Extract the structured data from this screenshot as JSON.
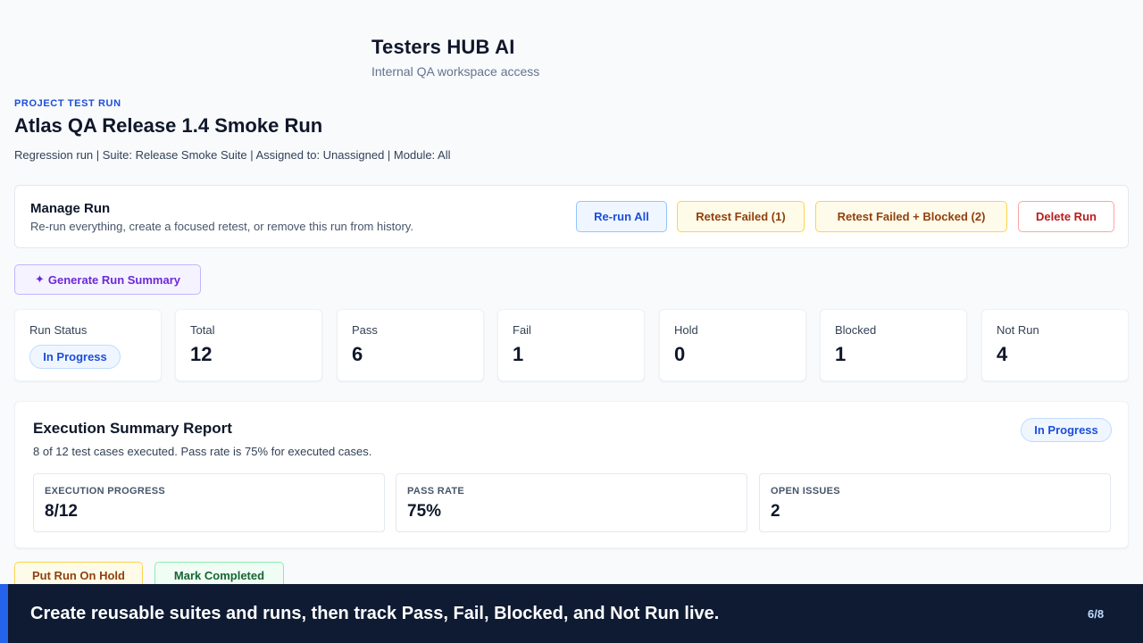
{
  "brand": {
    "title": "Testers HUB AI",
    "subtitle": "Internal QA workspace access"
  },
  "run": {
    "eyebrow": "PROJECT TEST RUN",
    "title": "Atlas QA Release 1.4 Smoke Run",
    "meta": "Regression run | Suite: Release Smoke Suite | Assigned to: Unassigned | Module: All"
  },
  "manage": {
    "title": "Manage Run",
    "description": "Re-run everything, create a focused retest, or remove this run from history.",
    "rerun_label": "Re-run All",
    "retest_failed_label": "Retest Failed (1)",
    "retest_failed_blocked_label": "Retest Failed + Blocked (2)",
    "delete_label": "Delete Run"
  },
  "generate": {
    "icon": "sparkle-icon",
    "label": "Generate Run Summary"
  },
  "stats": {
    "status": {
      "label": "Run Status",
      "value": "In Progress"
    },
    "total": {
      "label": "Total",
      "value": "12"
    },
    "pass": {
      "label": "Pass",
      "value": "6"
    },
    "fail": {
      "label": "Fail",
      "value": "1"
    },
    "hold": {
      "label": "Hold",
      "value": "0"
    },
    "blocked": {
      "label": "Blocked",
      "value": "1"
    },
    "not_run": {
      "label": "Not Run",
      "value": "4"
    }
  },
  "summary": {
    "title": "Execution Summary Report",
    "description": "8 of 12 test cases executed. Pass rate is 75% for executed cases.",
    "status": "In Progress",
    "metrics": [
      {
        "label": "EXECUTION PROGRESS",
        "value": "8/12"
      },
      {
        "label": "PASS RATE",
        "value": "75%"
      },
      {
        "label": "OPEN ISSUES",
        "value": "2"
      }
    ]
  },
  "actions": {
    "hold_label": "Put Run On Hold",
    "complete_label": "Mark Completed"
  },
  "banner": {
    "text": "Create reusable suites and runs, then track Pass, Fail, Blocked, and Not Run live.",
    "page": "6/8"
  },
  "colors": {
    "accent": "#2563eb",
    "banner_bg": "#0f1b33"
  }
}
